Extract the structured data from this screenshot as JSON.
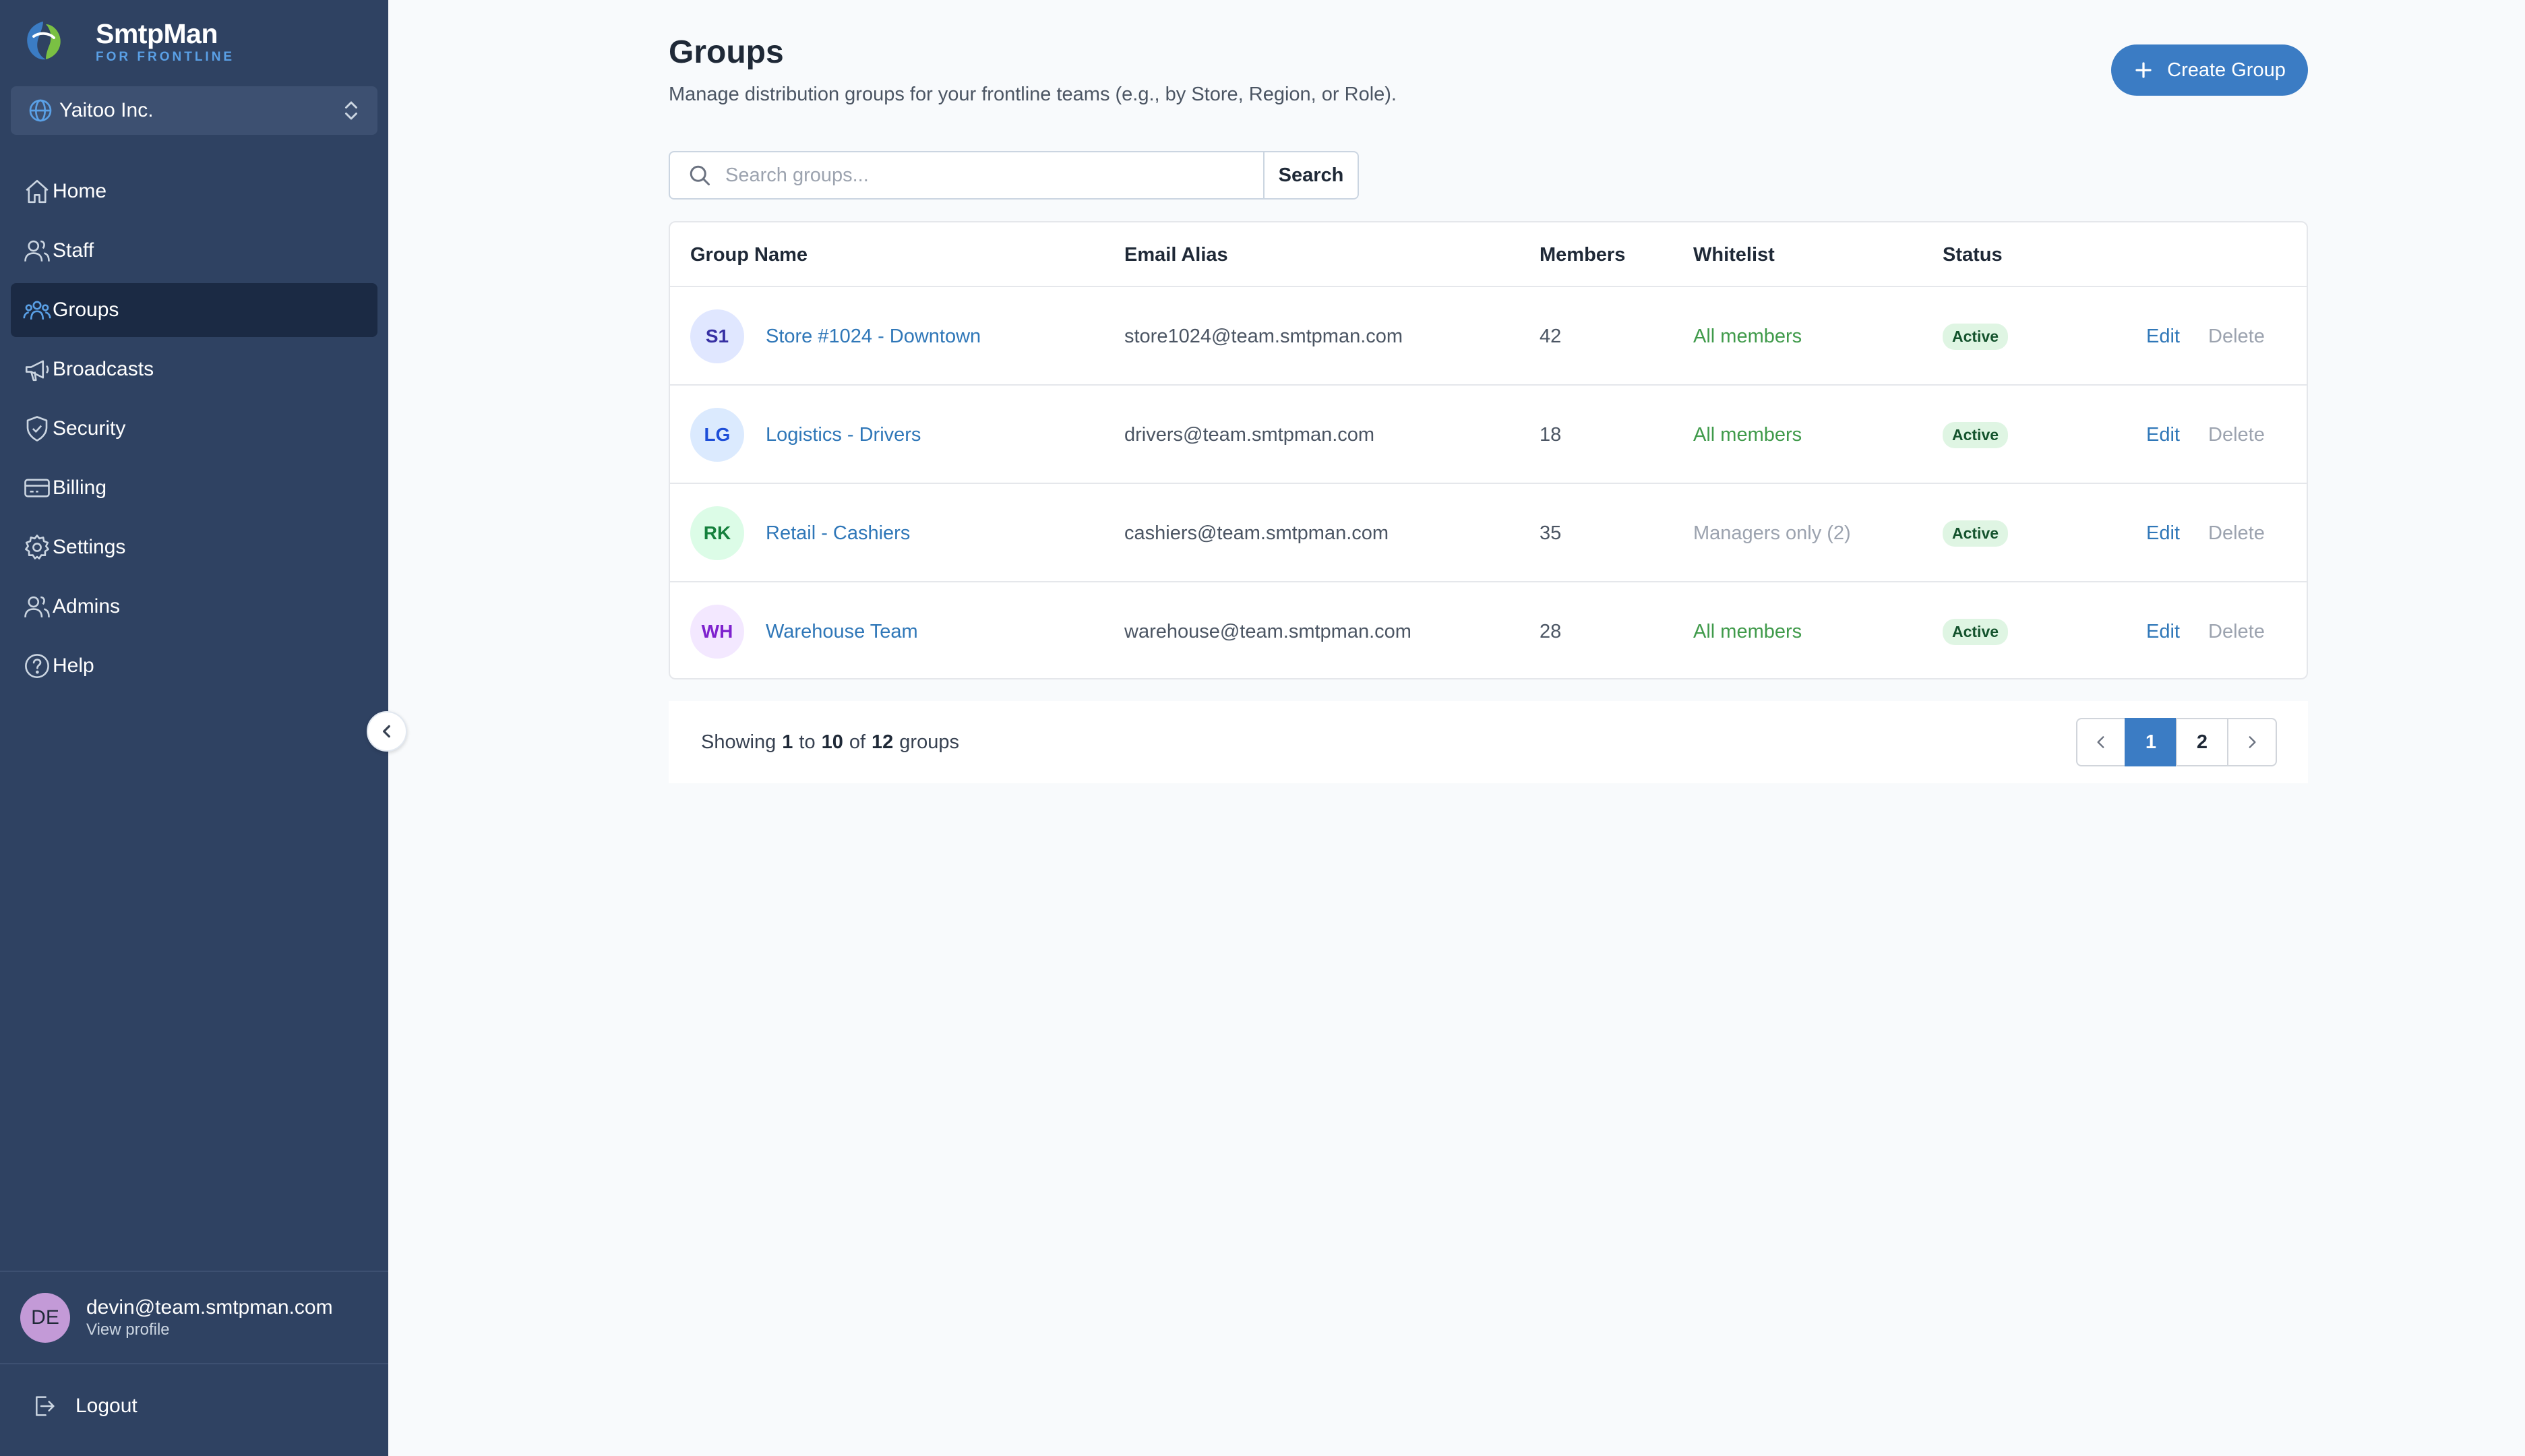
{
  "brand": {
    "name": "SmtpMan",
    "tagline": "FOR FRONTLINE"
  },
  "org_selector": {
    "value": "Yaitoo Inc.",
    "icon": "globe-icon"
  },
  "nav": {
    "items": [
      {
        "label": "Home",
        "icon": "home-icon",
        "active": false
      },
      {
        "label": "Staff",
        "icon": "user-icon",
        "active": false
      },
      {
        "label": "Groups",
        "icon": "users-icon",
        "active": true
      },
      {
        "label": "Broadcasts",
        "icon": "megaphone-icon",
        "active": false
      },
      {
        "label": "Security",
        "icon": "shield-icon",
        "active": false
      },
      {
        "label": "Billing",
        "icon": "credit-card-icon",
        "active": false
      },
      {
        "label": "Settings",
        "icon": "gear-icon",
        "active": false
      },
      {
        "label": "Admins",
        "icon": "user-icon",
        "active": false
      },
      {
        "label": "Help",
        "icon": "help-circle-icon",
        "active": false
      }
    ]
  },
  "profile": {
    "initials": "DE",
    "email": "devin@team.smtpman.com",
    "link": "View profile"
  },
  "logout": {
    "label": "Logout"
  },
  "page": {
    "title": "Groups",
    "subtitle": "Manage distribution groups for your frontline teams (e.g., by Store, Region, or Role).",
    "create_button": "Create Group"
  },
  "search": {
    "placeholder": "Search groups...",
    "button": "Search"
  },
  "table": {
    "headers": {
      "name": "Group Name",
      "email": "Email Alias",
      "members": "Members",
      "whitelist": "Whitelist",
      "status": "Status"
    },
    "rows": [
      {
        "initials": "S1",
        "name": "Store #1024 - Downtown",
        "email": "store1024@team.smtpman.com",
        "members": "42",
        "whitelist": "All members",
        "status": "Active",
        "edit": "Edit",
        "delete": "Delete",
        "avatar_bg": "#e0e7ff",
        "avatar_fg": "#3730a3"
      },
      {
        "initials": "LG",
        "name": "Logistics - Drivers",
        "email": "drivers@team.smtpman.com",
        "members": "18",
        "whitelist": "All members",
        "status": "Active",
        "edit": "Edit",
        "delete": "Delete",
        "avatar_bg": "#dbeafe",
        "avatar_fg": "#1d4ed8"
      },
      {
        "initials": "RK",
        "name": "Retail - Cashiers",
        "email": "cashiers@team.smtpman.com",
        "members": "35",
        "whitelist": "Managers only (2)",
        "status": "Active",
        "edit": "Edit",
        "delete": "Delete",
        "avatar_bg": "#dcfce7",
        "avatar_fg": "#15803d"
      },
      {
        "initials": "WH",
        "name": "Warehouse Team",
        "email": "warehouse@team.smtpman.com",
        "members": "28",
        "whitelist": "All members",
        "status": "Active",
        "edit": "Edit",
        "delete": "Delete",
        "avatar_bg": "#f3e8ff",
        "avatar_fg": "#7e22ce"
      }
    ]
  },
  "pagination": {
    "showing_prefix": "Showing",
    "from": "1",
    "to_word": "to",
    "to": "10",
    "of_word": "of",
    "total": "12",
    "suffix": "groups",
    "pages": [
      "1",
      "2"
    ],
    "current": "1"
  },
  "colors": {
    "sidebar_bg": "#2f4262",
    "sidebar_active": "#1b2a44",
    "accent": "#3b7cc4",
    "link": "#2f77b8",
    "success": "#3f9a4a"
  }
}
